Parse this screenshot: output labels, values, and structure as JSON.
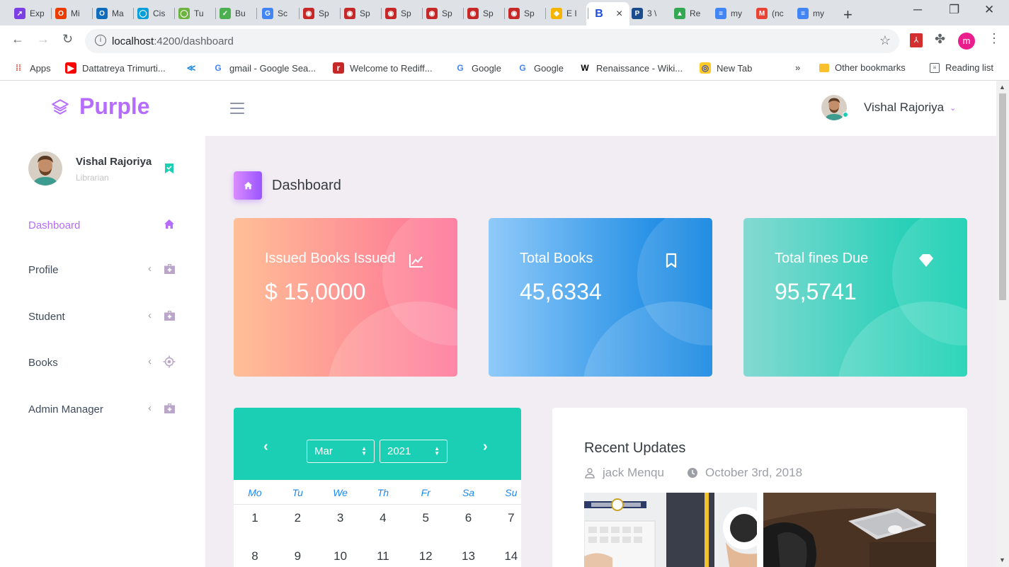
{
  "browser": {
    "tabs": [
      {
        "title": "Exp",
        "color": "#7b3fe4",
        "glyph": "➚"
      },
      {
        "title": "Mi",
        "color": "#eb3c00",
        "glyph": "O"
      },
      {
        "title": "Ma",
        "color": "#0f6cbd",
        "glyph": "O"
      },
      {
        "title": "Cis",
        "color": "#049fd9",
        "glyph": "◯"
      },
      {
        "title": "Tu",
        "color": "#6db33f",
        "glyph": "◯"
      },
      {
        "title": "Bu",
        "color": "#4caf50",
        "glyph": "✓"
      },
      {
        "title": "Sc",
        "color": "#4285f4",
        "glyph": "G"
      },
      {
        "title": "Sp",
        "color": "#c62828",
        "glyph": "◉"
      },
      {
        "title": "Sp",
        "color": "#c62828",
        "glyph": "◉"
      },
      {
        "title": "Sp",
        "color": "#c62828",
        "glyph": "◉"
      },
      {
        "title": "Sp",
        "color": "#c62828",
        "glyph": "◉"
      },
      {
        "title": "Sp",
        "color": "#c62828",
        "glyph": "◉"
      },
      {
        "title": "Sp",
        "color": "#c62828",
        "glyph": "◉"
      },
      {
        "title": "E I",
        "color": "#f4b400",
        "glyph": "◆"
      }
    ],
    "active_tab": {
      "title": "B",
      "close": "×"
    },
    "tabs_after": [
      {
        "title": "3 \\",
        "color": "#1a4b8c",
        "glyph": "P"
      },
      {
        "title": "Re",
        "color": "#34a853",
        "glyph": "▲"
      },
      {
        "title": "my",
        "color": "#4285f4",
        "glyph": "≡"
      },
      {
        "title": "(nc",
        "color": "#ea4335",
        "glyph": "M"
      },
      {
        "title": "my",
        "color": "#4285f4",
        "glyph": "≡"
      }
    ],
    "new_tab": "+",
    "window_controls": {
      "minimize": "─",
      "restore": "❐",
      "close": "✕"
    },
    "url_host": "localhost",
    "url_path": ":4200/dashboard",
    "bookmarks": [
      {
        "label": "Apps",
        "icon": "apps-grid-icon"
      },
      {
        "label": "Dattatreya Trimurti...",
        "icon": "youtube-icon"
      },
      {
        "label": "",
        "icon": "kotak-icon"
      },
      {
        "label": "gmail - Google Sea...",
        "icon": "google-icon"
      },
      {
        "label": "Welcome to Rediff...",
        "icon": "rediff-icon"
      },
      {
        "label": "Google",
        "icon": "google-icon"
      },
      {
        "label": "Google",
        "icon": "google-icon"
      },
      {
        "label": "Renaissance - Wiki...",
        "icon": "wikipedia-icon"
      },
      {
        "label": "New Tab",
        "icon": "globe-icon"
      }
    ],
    "more_bookmarks": "»",
    "other_bookmarks": "Other bookmarks",
    "reading_list": "Reading list",
    "extension_avatar_letter": "m"
  },
  "app": {
    "brand": "Purple",
    "user_name": "Vishal Rajoriya",
    "sidebar": {
      "profile_name": "Vishal Rajoriya",
      "profile_role": "Librarian",
      "items": [
        {
          "label": "Dashboard",
          "icon": "home-icon"
        },
        {
          "label": "Profile",
          "icon": "medical-bag-icon",
          "chevron": "‹"
        },
        {
          "label": "Student",
          "icon": "medical-bag-icon",
          "chevron": "‹"
        },
        {
          "label": "Books",
          "icon": "crosshairs-gps-icon",
          "chevron": "‹"
        },
        {
          "label": "Admin Manager",
          "icon": "medical-bag-icon",
          "chevron": "‹"
        }
      ]
    },
    "page_title": "Dashboard",
    "cards": [
      {
        "title": "Issued Books Issued",
        "value": "$ 15,0000",
        "icon": "chart-line-icon"
      },
      {
        "title": "Total Books",
        "value": "45,6334",
        "icon": "bookmark-outline-icon"
      },
      {
        "title": "Total fines Due",
        "value": "95,5741",
        "icon": "diamond-icon"
      }
    ],
    "calendar": {
      "month": "Mar",
      "year": "2021",
      "prev": "‹",
      "next": "›",
      "weekdays": [
        "Mo",
        "Tu",
        "We",
        "Th",
        "Fr",
        "Sa",
        "Su"
      ],
      "weeks": [
        [
          "1",
          "2",
          "3",
          "4",
          "5",
          "6",
          "7"
        ],
        [
          "8",
          "9",
          "10",
          "11",
          "12",
          "13",
          "14"
        ]
      ]
    },
    "updates": {
      "title": "Recent Updates",
      "author": "jack Menqu",
      "date": "October 3rd, 2018"
    },
    "colors": {
      "brand": "#b66dff",
      "main_bg": "#f2edf3",
      "calendar_header": "#1bcfb4",
      "weekday_text": "#1c8af0"
    }
  }
}
